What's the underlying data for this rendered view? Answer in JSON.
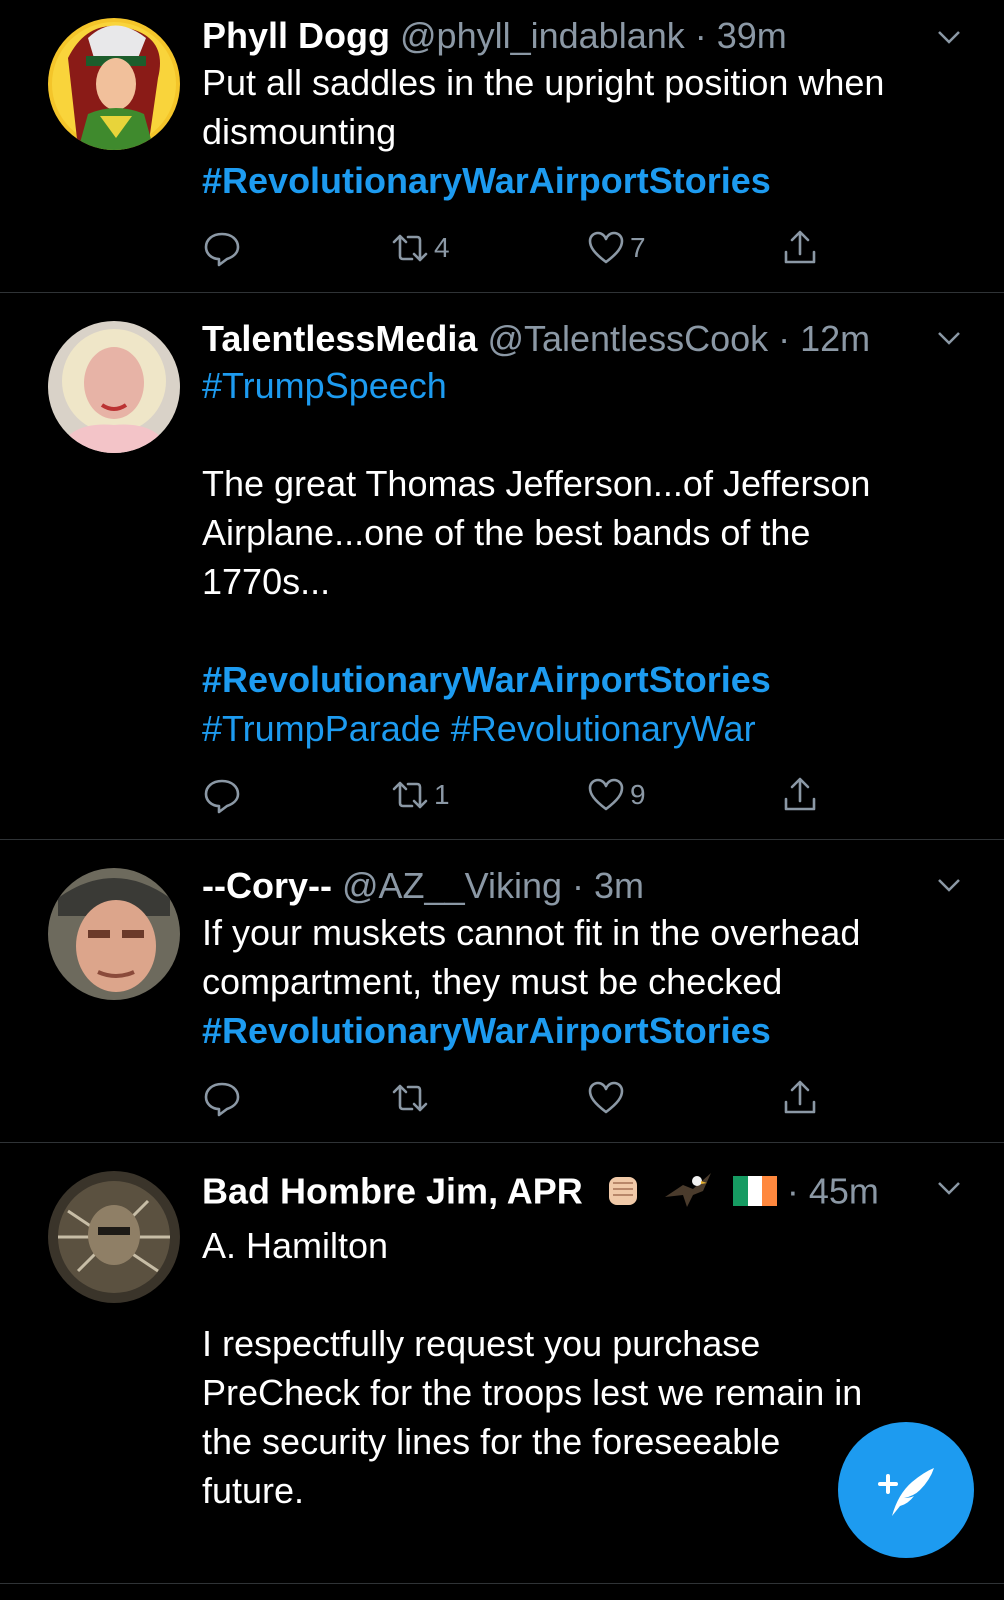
{
  "tweets": [
    {
      "name": "Phyll Dogg",
      "handle": "@phyll_indablank",
      "time": "39m",
      "lines": [
        "Put all saddles in the upright position when",
        "dismounting"
      ],
      "tags": [
        "#RevolutionaryWarAirportStories"
      ],
      "reply_count": "",
      "retweet_count": "4",
      "like_count": "7"
    },
    {
      "name": "TalentlessMedia",
      "handle": "@TalentlessCook",
      "time": "12m",
      "tag_top": "#TrumpSpeech",
      "lines": [
        "The great Thomas Jefferson...of Jefferson",
        "Airplane...one of the best bands of the",
        "1770s..."
      ],
      "tag_bold": "#RevolutionaryWarAirportStories",
      "tag_line2": "#TrumpParade #RevolutionaryWar",
      "retweet_count": "1",
      "like_count": "9"
    },
    {
      "name": "--Cory--",
      "handle": "@AZ__Viking",
      "time": "3m",
      "lines": [
        "If your muskets cannot fit in the overhead",
        "compartment, they must be checked"
      ],
      "tags": [
        "#RevolutionaryWarAirportStories"
      ],
      "retweet_count": "",
      "like_count": ""
    },
    {
      "name": "Bad Hombre Jim, APR",
      "handle": "",
      "time": "45m",
      "lines": [
        "A. Hamilton",
        "",
        "I respectfully request you purchase",
        "PreCheck for the troops lest we remain in",
        "the security lines for the foreseeable",
        "future."
      ]
    }
  ],
  "separator": "·",
  "icons": {
    "reply": "reply-icon",
    "retweet": "retweet-icon",
    "like": "heart-icon",
    "share": "share-icon",
    "more": "chevron-down-icon",
    "compose": "compose-icon"
  },
  "colors": {
    "accent": "#1d9bf0",
    "muted": "#8b98a5",
    "bg": "#000000"
  }
}
